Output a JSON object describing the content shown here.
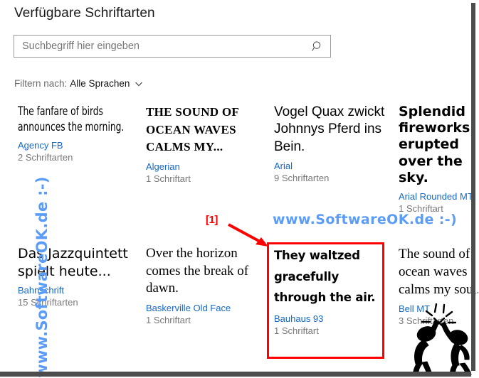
{
  "header": {
    "title": "Verfügbare Schriftarten"
  },
  "search": {
    "placeholder": "Suchbegriff hier eingeben",
    "value": "",
    "icon": "search-icon"
  },
  "filter": {
    "label": "Filtern nach:",
    "value": "Alle Sprachen",
    "icon": "chevron-down-icon"
  },
  "fonts": [
    {
      "sample": "The fanfare of birds announces the morning.",
      "name": "Agency FB",
      "count": "2 Schriftarten",
      "style": "s-agency"
    },
    {
      "sample": "The sound of ocean waves calms my...",
      "name": "Algerian",
      "count": "1 Schriftart",
      "style": "s-algerian"
    },
    {
      "sample": "Vogel Quax zwickt Johnnys Pferd ins Bein.",
      "name": "Arial",
      "count": "9 Schriftarten",
      "style": "s-arial"
    },
    {
      "sample": "Splendid fireworks erupted over the sky.",
      "name": "Arial Rounded MT",
      "count": "1 Schriftart",
      "style": "s-arialrnd"
    },
    {
      "sample": "Das Jazzquintett spielt heute...",
      "name": "Bahnschrift",
      "count": "15 Schriftarten",
      "style": "s-bahn"
    },
    {
      "sample": "Over the horizon comes the break of dawn.",
      "name": "Baskerville Old Face",
      "count": "1 Schriftart",
      "style": "s-baskerv"
    },
    {
      "sample": "They waltzed gracefully through the air.",
      "name": "Bauhaus 93",
      "count": "1 Schriftart",
      "style": "s-bauhaus"
    },
    {
      "sample": "The sound of ocean waves calms my soul.",
      "name": "Bell MT",
      "count": "3 Schriftarten",
      "style": "s-bell"
    }
  ],
  "annotation": {
    "tag": "[1]",
    "color": "#ff0000",
    "highlight_target": "Bauhaus 93"
  },
  "watermark": {
    "horizontal": "www.SoftwareOK.de :-)",
    "vertical": "www.SoftwareOK.de :-)",
    "color": "#5a9cf8"
  },
  "colors": {
    "link": "#1668c7",
    "muted": "#787878",
    "text": "#1a1a1a",
    "border": "#9a9a9a",
    "scrollbar": "#4d4d4d"
  }
}
